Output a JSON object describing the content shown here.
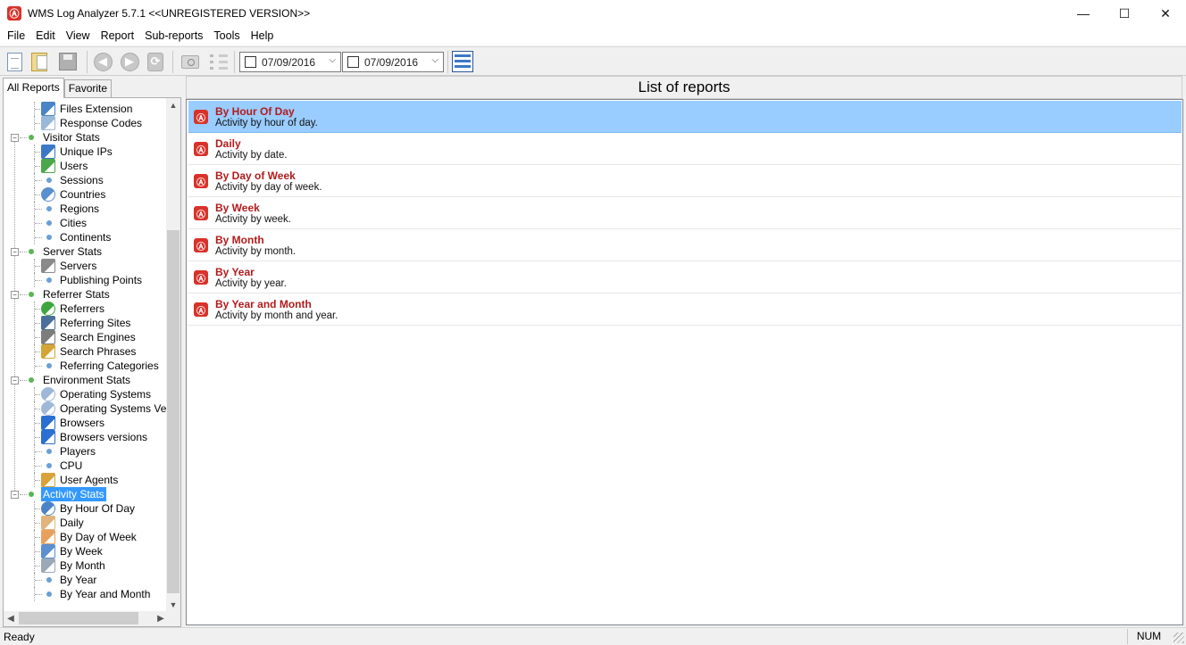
{
  "window": {
    "title": "WMS Log Analyzer 5.7.1 <<UNREGISTERED VERSION>>",
    "app_icon_glyph": "Ⓐ",
    "minimize_glyph": "—",
    "maximize_glyph": "☐",
    "close_glyph": "✕"
  },
  "menu": [
    "File",
    "Edit",
    "View",
    "Report",
    "Sub-reports",
    "Tools",
    "Help"
  ],
  "toolbar": {
    "date_from": "07/09/2016",
    "date_to": "07/09/2016",
    "dropdown_glyph": "⌵",
    "back_glyph": "◀",
    "forward_glyph": "▶",
    "refresh_glyph": "⟳",
    "icons": [
      "new-document-icon",
      "open-folder-icon",
      "save-disk-icon",
      "back-arrow-icon",
      "forward-arrow-icon",
      "refresh-icon",
      "camera-icon",
      "list-view-icon",
      "date-from-picker",
      "date-to-picker",
      "report-grid-icon"
    ]
  },
  "left_panel": {
    "tabs": [
      "All Reports",
      "Favorite"
    ],
    "tree": [
      {
        "type": "leaf",
        "label": "Files Extension",
        "icon": "table-icon"
      },
      {
        "type": "leaf",
        "label": "Response Codes",
        "icon": "speech-bubble-icon"
      },
      {
        "type": "category",
        "label": "Visitor Stats"
      },
      {
        "type": "leaf",
        "label": "Unique IPs",
        "icon": "person-icon"
      },
      {
        "type": "leaf",
        "label": "Users",
        "icon": "user-green-icon"
      },
      {
        "type": "leaf",
        "label": "Sessions",
        "icon": "dot"
      },
      {
        "type": "leaf",
        "label": "Countries",
        "icon": "globe-icon"
      },
      {
        "type": "leaf",
        "label": "Regions",
        "icon": "dot"
      },
      {
        "type": "leaf",
        "label": "Cities",
        "icon": "dot"
      },
      {
        "type": "leaf",
        "label": "Continents",
        "icon": "dot"
      },
      {
        "type": "category",
        "label": "Server Stats"
      },
      {
        "type": "leaf",
        "label": "Servers",
        "icon": "server-icon"
      },
      {
        "type": "leaf",
        "label": "Publishing Points",
        "icon": "dot"
      },
      {
        "type": "category",
        "label": "Referrer Stats"
      },
      {
        "type": "leaf",
        "label": "Referrers",
        "icon": "green-globe-icon"
      },
      {
        "type": "leaf",
        "label": "Referring Sites",
        "icon": "monitor-icon"
      },
      {
        "type": "leaf",
        "label": "Search Engines",
        "icon": "search-engine-icon"
      },
      {
        "type": "leaf",
        "label": "Search Phrases",
        "icon": "magnifier-icon"
      },
      {
        "type": "leaf",
        "label": "Referring Categories",
        "icon": "dot"
      },
      {
        "type": "category",
        "label": "Environment Stats"
      },
      {
        "type": "leaf",
        "label": "Operating Systems",
        "icon": "cd-icon"
      },
      {
        "type": "leaf",
        "label": "Operating Systems Versio",
        "icon": "cd-icon"
      },
      {
        "type": "leaf",
        "label": "Browsers",
        "icon": "ie-browser-icon"
      },
      {
        "type": "leaf",
        "label": "Browsers versions",
        "icon": "ie-browser-icon"
      },
      {
        "type": "leaf",
        "label": "Players",
        "icon": "dot"
      },
      {
        "type": "leaf",
        "label": "CPU",
        "icon": "dot"
      },
      {
        "type": "leaf",
        "label": "User Agents",
        "icon": "user-agent-icon"
      },
      {
        "type": "category",
        "label": "Activity Stats",
        "selected": true
      },
      {
        "type": "leaf",
        "label": "By Hour Of Day",
        "icon": "clock-icon"
      },
      {
        "type": "leaf",
        "label": "Daily",
        "icon": "calendar-day-icon"
      },
      {
        "type": "leaf",
        "label": "By Day of Week",
        "icon": "calendar-week-icon"
      },
      {
        "type": "leaf",
        "label": "By Week",
        "icon": "calendar-grid-icon"
      },
      {
        "type": "leaf",
        "label": "By Month",
        "icon": "calendar-month-icon"
      },
      {
        "type": "leaf",
        "label": "By Year",
        "icon": "dot"
      },
      {
        "type": "leaf",
        "label": "By Year and Month",
        "icon": "dot"
      }
    ]
  },
  "main": {
    "title": "List of reports",
    "reports": [
      {
        "title": "By Hour Of Day",
        "desc": "Activity by hour of day.",
        "selected": true
      },
      {
        "title": "Daily",
        "desc": "Activity by date."
      },
      {
        "title": "By Day of Week",
        "desc": "Activity by day of week."
      },
      {
        "title": "By Week",
        "desc": "Activity by week."
      },
      {
        "title": "By Month",
        "desc": "Activity by month."
      },
      {
        "title": "By Year",
        "desc": "Activity by year."
      },
      {
        "title": "By Year and Month",
        "desc": "Activity by month and year."
      }
    ]
  },
  "status": {
    "text": "Ready",
    "num": "NUM"
  },
  "colors": {
    "accent": "#d9322a",
    "selected_row": "#99ccff",
    "report_title": "#b31b1b",
    "tree_selection": "#3399ff"
  }
}
